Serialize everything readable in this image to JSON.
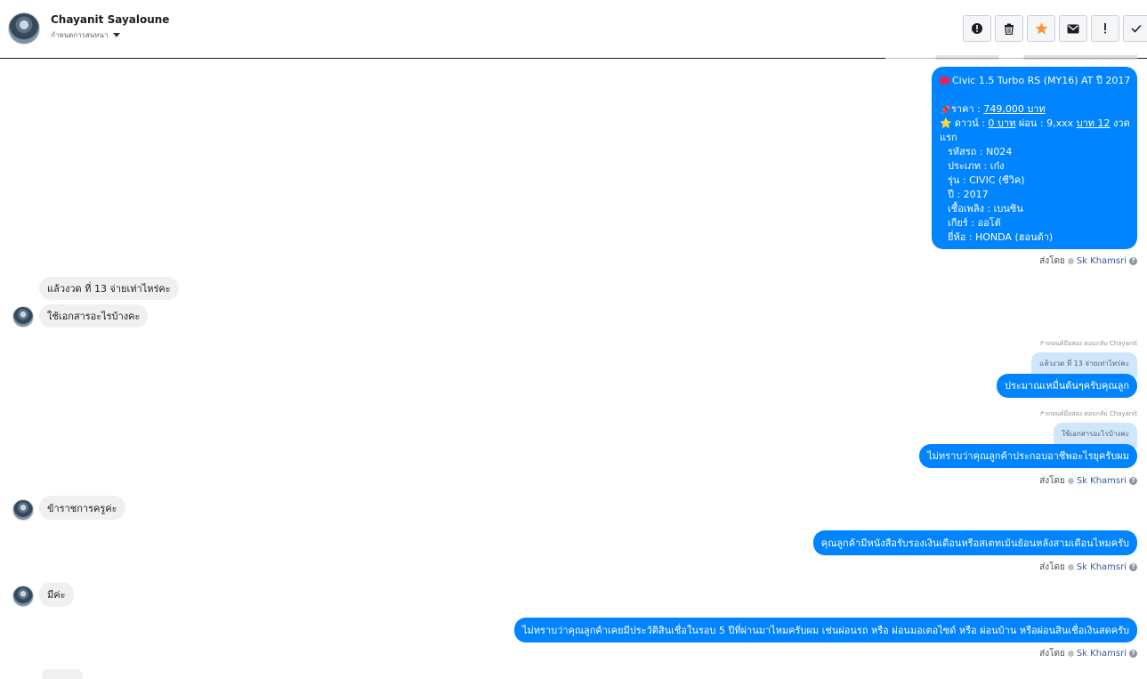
{
  "header": {
    "name": "Chayanit Sayaloune",
    "subtitle": "กำหนดการสนทนา"
  },
  "toolbar": {
    "buttons": [
      {
        "icon": "alert-circle-icon"
      },
      {
        "icon": "trash-icon"
      },
      {
        "icon": "star-icon",
        "color": "#f7923b"
      },
      {
        "icon": "mail-icon"
      },
      {
        "icon": "exclamation-icon"
      },
      {
        "icon": "check-icon"
      }
    ]
  },
  "card": {
    "title": "Civic 1.5 Turbo RS (MY16) AT ปี 2017",
    "price_label": "ราคา : ",
    "price_value": "749,000 บาท",
    "down_label": "ดาวน์ : ",
    "down_value": "0 บาท",
    "installment_label": " ผ่อน : 9,xxx ",
    "installment_value": "บาท 12",
    "installment_suffix": " งวด",
    "installment_tail": "แรก",
    "details": [
      "รหัสรถ : N024",
      "ประเภท : เก๋ง",
      "รุ่น : CIVIC (ซีวิค)",
      "ปี : 2017",
      "เชื้อเพลิง : เบนซิน",
      "เกียร์ : ออโต้",
      "ยี่ห้อ : HONDA (ฮอนด้า)"
    ]
  },
  "sent_by": {
    "label": "ส่งโดย",
    "agent": "Sk Khamsri"
  },
  "messages": {
    "in1": "แล้วงวด ที่ 13  จ่ายเท่าไหร่คะ",
    "in2": "ใช้เอกสารอะไรบ้างคะ",
    "reply_note": "↱รถยนต์มือสอง ตอบกลับ Chayanit",
    "quote1": "แล้วงวด ที่ 13 จ่ายเท่าไหร่คะ",
    "out1": "ประมาณเหมื่นต้นๆครับคุณลูก",
    "quote2": "ใช้เอกสารอะไรบ้างคะ",
    "out2": "ไม่ทราบว่าคุณลูกค้าประกอบอาชีพอะไรยุครับผม",
    "in3": "ข้าราชการครูค่ะ",
    "out3": "คุณลูกค้ามีหนังสือรับรองเงินเดือนหรือสเตทเม้นย้อนหลังสามเดือนไหมครับ",
    "in4": "มีค่ะ",
    "out4": "ไม่ทราบว่าคุณลูกค้าเคยมีประวัติสินเชื่อในรอบ 5 ปีที่ผ่านมาไหมครับผม เช่นผ่อนรถ หรือ ผ่อนมอเตอไซด์ หรือ ผ่อนบ้าน หรือผ่อนสินเชื่อเงินสดครับ"
  },
  "colors": {
    "outgoing": "#0084ff",
    "incoming": "#f1f0f0",
    "quote": "#cfe6fd"
  }
}
